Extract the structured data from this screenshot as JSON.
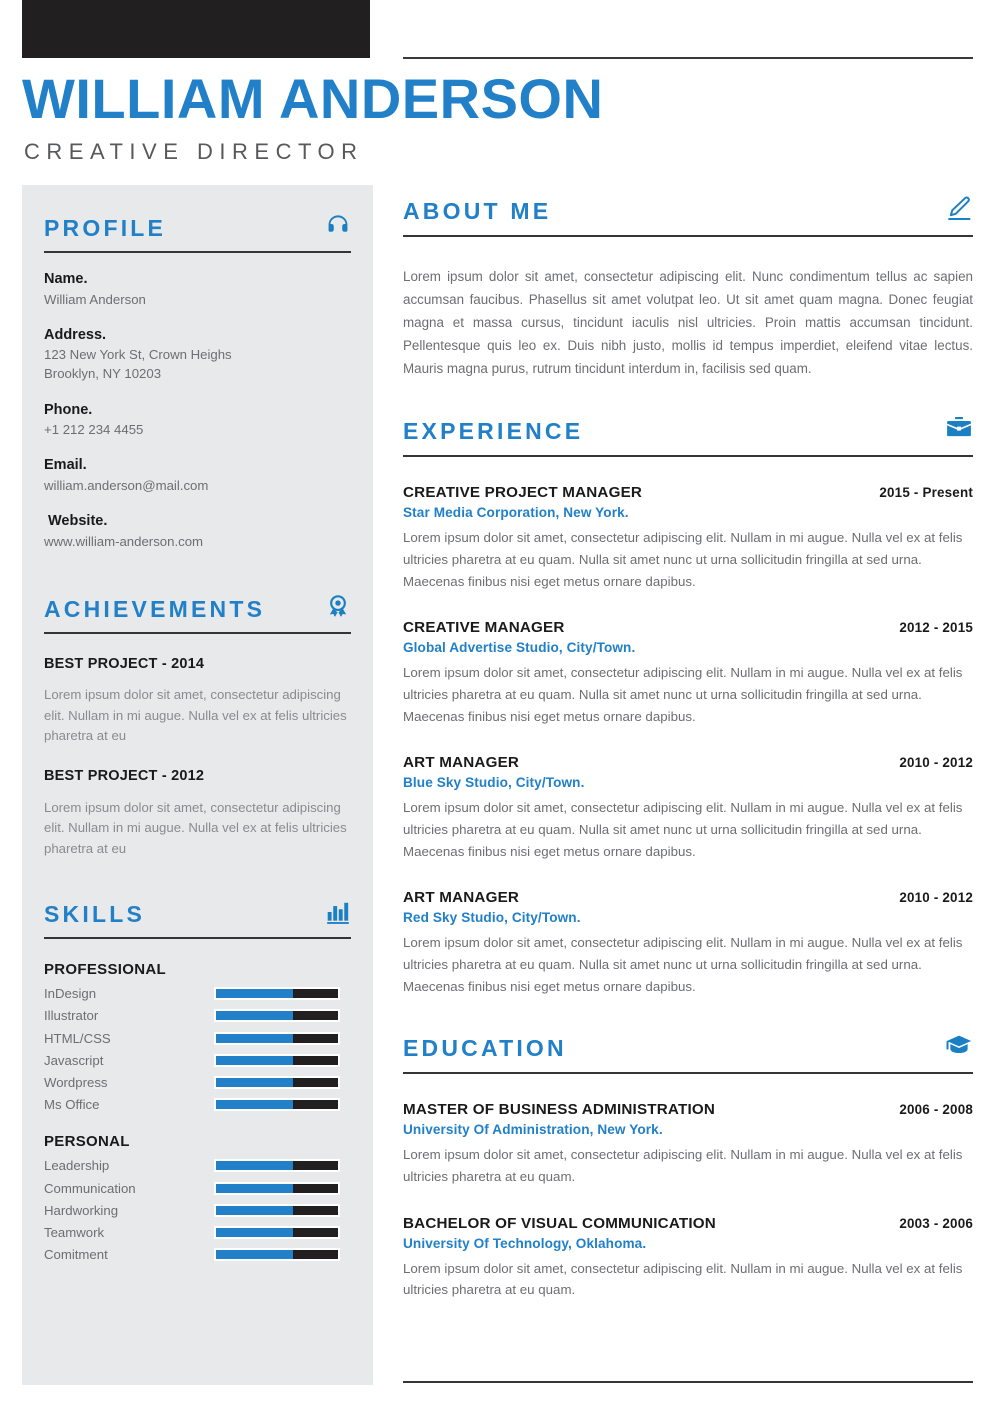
{
  "header": {
    "name": "WILLIAM ANDERSON",
    "role": "CREATIVE DIRECTOR"
  },
  "accent_color": "#2180c8",
  "dark_color": "#211f1f",
  "sidebar_bg": "#e8e9ea",
  "sidebar": {
    "profile": {
      "title": "PROFILE",
      "icon": "headphones-icon",
      "fields": [
        {
          "label": "Name.",
          "value": "William Anderson"
        },
        {
          "label": "Address.",
          "value": "123 New York St, Crown Heighs",
          "value2": "Brooklyn, NY 10203"
        },
        {
          "label": "Phone.",
          "value": "+1 212 234 4455"
        },
        {
          "label": "Email.",
          "value": "william.anderson@mail.com"
        },
        {
          "label": "Website.",
          "value": "www.william-anderson.com"
        }
      ]
    },
    "achievements": {
      "title": "ACHIEVEMENTS",
      "icon": "award-medal-icon",
      "items": [
        {
          "title": "BEST PROJECT - 2014",
          "body": "Lorem ipsum dolor sit amet, consectetur adipiscing elit. Nullam in mi augue. Nulla vel ex at felis ultricies pharetra at eu"
        },
        {
          "title": "BEST PROJECT - 2012",
          "body": "Lorem ipsum dolor sit amet, consectetur adipiscing elit. Nullam in mi augue. Nulla vel ex at felis ultricies pharetra at eu"
        }
      ]
    },
    "skills": {
      "title": "SKILLS",
      "icon": "bar-chart-icon",
      "groups": [
        {
          "name": "PROFESSIONAL",
          "items": [
            {
              "name": "InDesign",
              "level": 63
            },
            {
              "name": "Illustrator",
              "level": 63
            },
            {
              "name": "HTML/CSS",
              "level": 63
            },
            {
              "name": "Javascript",
              "level": 63
            },
            {
              "name": "Wordpress",
              "level": 63
            },
            {
              "name": "Ms Office",
              "level": 63
            }
          ]
        },
        {
          "name": "PERSONAL",
          "items": [
            {
              "name": "Leadership",
              "level": 63
            },
            {
              "name": "Communication",
              "level": 63
            },
            {
              "name": "Hardworking",
              "level": 63
            },
            {
              "name": "Teamwork",
              "level": 63
            },
            {
              "name": "Comitment",
              "level": 63
            }
          ]
        }
      ]
    }
  },
  "main": {
    "about": {
      "title": "ABOUT ME",
      "icon": "pencil-edit-icon",
      "body": "Lorem ipsum dolor sit amet, consectetur adipiscing elit. Nunc condimentum tellus ac sapien accumsan faucibus. Phasellus sit amet volutpat leo. Ut sit amet quam magna. Donec feugiat magna et massa cursus, tincidunt iaculis nisl ultricies. Proin mattis accumsan tincidunt. Pellentesque quis leo ex. Duis nibh justo, mollis id tempus imperdiet, eleifend vitae lectus. Mauris magna purus, rutrum tincidunt interdum in, facilisis sed quam."
    },
    "experience": {
      "title": "EXPERIENCE",
      "icon": "briefcase-icon",
      "entries": [
        {
          "title": "CREATIVE PROJECT MANAGER",
          "date": "2015 - Present",
          "org": "Star Media Corporation, New York.",
          "body": "Lorem ipsum dolor sit amet, consectetur adipiscing elit. Nullam in mi augue. Nulla vel ex at felis ultricies pharetra at eu quam. Nulla sit amet nunc ut urna sollicitudin fringilla at sed urna. Maecenas finibus nisi eget metus ornare dapibus."
        },
        {
          "title": "CREATIVE MANAGER",
          "date": "2012 - 2015",
          "org": "Global Advertise Studio, City/Town.",
          "body": "Lorem ipsum dolor sit amet, consectetur adipiscing elit. Nullam in mi augue. Nulla vel ex at felis ultricies pharetra at eu quam. Nulla sit amet nunc ut urna sollicitudin fringilla at sed urna. Maecenas finibus nisi eget metus ornare dapibus."
        },
        {
          "title": "ART MANAGER",
          "date": "2010 - 2012",
          "org": "Blue Sky Studio, City/Town.",
          "body": "Lorem ipsum dolor sit amet, consectetur adipiscing elit. Nullam in mi augue. Nulla vel ex at felis ultricies pharetra at eu quam. Nulla sit amet nunc ut urna sollicitudin fringilla at sed urna. Maecenas finibus nisi eget metus ornare dapibus."
        },
        {
          "title": "ART MANAGER",
          "date": "2010 - 2012",
          "org": "Red Sky Studio, City/Town.",
          "body": "Lorem ipsum dolor sit amet, consectetur adipiscing elit. Nullam in mi augue. Nulla vel ex at felis ultricies pharetra at eu quam. Nulla sit amet nunc ut urna sollicitudin fringilla at sed urna. Maecenas finibus nisi eget metus ornare dapibus."
        }
      ]
    },
    "education": {
      "title": "EDUCATION",
      "icon": "graduation-cap-icon",
      "entries": [
        {
          "title": "MASTER OF BUSINESS ADMINISTRATION",
          "date": "2006 - 2008",
          "org": "University Of Administration, New York.",
          "body": "Lorem ipsum dolor sit amet, consectetur adipiscing elit. Nullam in mi augue. Nulla vel ex at felis ultricies pharetra at eu quam."
        },
        {
          "title": "BACHELOR OF VISUAL COMMUNICATION",
          "date": "2003 - 2006",
          "org": "University Of Technology, Oklahoma.",
          "body": "Lorem ipsum dolor sit amet, consectetur adipiscing elit. Nullam in mi augue. Nulla vel ex at felis ultricies pharetra at eu quam."
        }
      ]
    }
  }
}
